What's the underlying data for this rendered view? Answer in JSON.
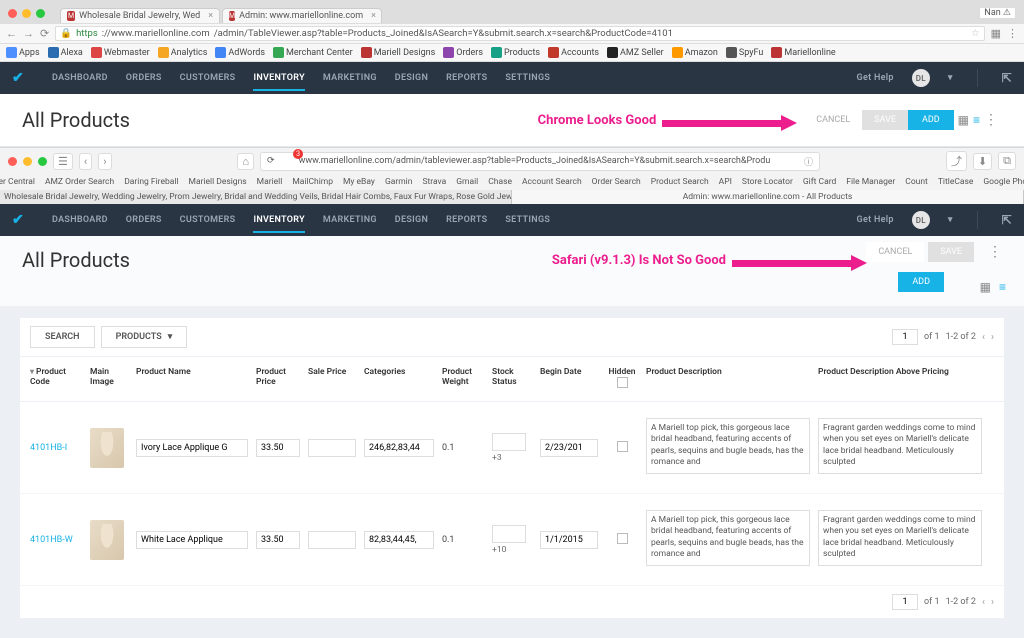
{
  "chrome": {
    "user_chip": "Nan ⚠",
    "tabs": [
      {
        "favicon": "M",
        "title": "Wholesale Bridal Jewelry, Wed"
      },
      {
        "favicon": "M",
        "title": "Admin: www.mariellonline.com"
      }
    ],
    "url_secure_prefix": "https",
    "url_host": "://www.mariellonline.com",
    "url_path": "/admin/TableViewer.asp?table=Products_Joined&IsASearch=Y&submit.search.x=search&ProductCode=4101",
    "bookmarks": [
      "Apps",
      "Alexa",
      "Webmaster",
      "Analytics",
      "AdWords",
      "Merchant Center",
      "Mariell Designs",
      "Orders",
      "Products",
      "Accounts",
      "AMZ Seller",
      "Amazon",
      "SpyFu",
      "Mariellonline"
    ]
  },
  "vnav": {
    "items": [
      "DASHBOARD",
      "ORDERS",
      "CUSTOMERS",
      "INVENTORY",
      "MARKETING",
      "DESIGN",
      "REPORTS",
      "SETTINGS"
    ],
    "active_index": 3,
    "get_help": "Get Help",
    "avatar": "DL"
  },
  "page": {
    "title": "All Products",
    "annot_chrome": "Chrome Looks Good",
    "annot_safari": "Safari (v9.1.3) Is Not So Good",
    "btn_cancel": "CANCEL",
    "btn_save": "SAVE",
    "btn_add": "ADD"
  },
  "safari": {
    "url": "www.mariellonline.com/admin/tableviewer.asp?table=Products_Joined&IsASearch=Y&submit.search.x=search&Produ",
    "badge": "3",
    "bookmarks": [
      "Seller Central",
      "AMZ Order Search",
      "Daring Fireball",
      "Mariell Designs",
      "Mariell",
      "MailChimp",
      "My eBay",
      "Garmin",
      "Strava",
      "Gmail",
      "Chase",
      "Account Search",
      "Order Search",
      "Product Search",
      "API",
      "Store Locator",
      "Gift Card",
      "File Manager",
      "Count",
      "TitleCase",
      "Google Photos"
    ],
    "tabs": [
      "Wholesale Bridal Jewelry, Wedding Jewelry, Prom Jewelry, Bridal and Wedding Veils, Bridal Hair Combs, Faux Fur Wraps, Rose Gold Jewelry, Cubic Zirconia Jewelr...",
      "Admin: www.mariellonline.com - All Products"
    ],
    "active_tab": 1
  },
  "toolbar": {
    "search": "SEARCH",
    "products": "PRODUCTS",
    "page_current": "1",
    "page_of": "of 1",
    "page_range": "1-2 of 2"
  },
  "columns": {
    "code": "Product Code",
    "img": "Main Image",
    "name": "Product Name",
    "price": "Product Price",
    "sale": "Sale Price",
    "cat": "Categories",
    "weight": "Product Weight",
    "stock": "Stock Status",
    "begin": "Begin Date",
    "hidden": "Hidden",
    "desc": "Product Description",
    "desc2": "Product Description Above Pricing"
  },
  "rows": [
    {
      "code": "4101HB-I",
      "name": "Ivory Lace Applique G",
      "price": "33.50",
      "sale": "",
      "cat": "246,82,83,44",
      "weight": "0.1",
      "stock": "",
      "stock_plus": "+3",
      "begin": "2/23/201",
      "hidden": false,
      "desc": "A Mariell top pick, this gorgeous lace bridal headband, featuring accents of pearls, sequins and bugle beads, has the romance and",
      "desc2": "Fragrant garden weddings come to mind when you set eyes on Mariell's delicate lace bridal headband. Meticulously sculpted"
    },
    {
      "code": "4101HB-W",
      "name": "White Lace Applique",
      "price": "33.50",
      "sale": "",
      "cat": "82,83,44,45,",
      "weight": "0.1",
      "stock": "",
      "stock_plus": "+10",
      "begin": "1/1/2015",
      "hidden": false,
      "desc": "A Mariell top pick, this gorgeous lace bridal headband, featuring accents of pearls, sequins and bugle beads, has the romance and",
      "desc2": "Fragrant garden weddings come to mind when you set eyes on Mariell's delicate lace bridal headband. Meticulously sculpted"
    }
  ]
}
